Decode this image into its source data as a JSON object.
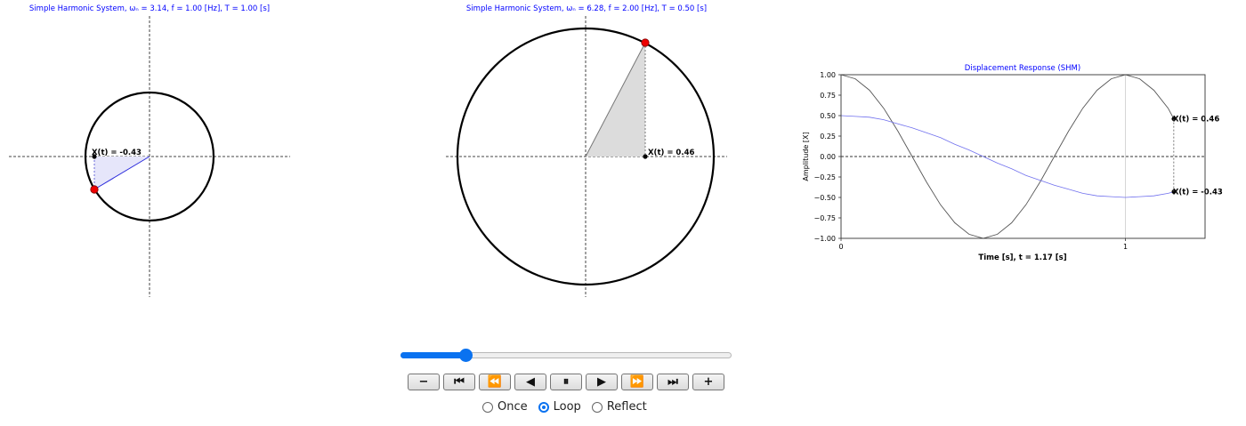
{
  "panel_left": {
    "title": "Simple Harmonic System, ωₙ  = 3.14, f = 1.00 [Hz], T = 1.00 [s]",
    "label": "X(t) = -0.43",
    "title_color": "#0000ff",
    "shade_color": "#e6e6fa",
    "radius_color": "#2b2bdc"
  },
  "panel_middle": {
    "title": "Simple Harmonic System, ωₙ  = 6.28, f = 2.00 [Hz], T = 0.50 [s]",
    "label": "X(t) = 0.46",
    "title_color": "#0000ff",
    "shade_color": "#dcdcdc",
    "radius_color": "#777777"
  },
  "chart_data": {
    "type": "line",
    "title": "Displacement Response (SHM)",
    "xlabel": "Time [s], t = 1.17 [s]",
    "ylabel": "Amplitude [X]",
    "xlim": [
      0,
      1.28
    ],
    "ylim": [
      -1.0,
      1.0
    ],
    "xticks": [
      "0",
      "1"
    ],
    "xtick_values": [
      0,
      1
    ],
    "yticks": [
      "1.00",
      "0.75",
      "0.50",
      "0.25",
      "0.00",
      "−0.25",
      "−0.50",
      "−0.75",
      "−1.00"
    ],
    "ytick_values": [
      1.0,
      0.75,
      0.5,
      0.25,
      0.0,
      -0.25,
      -0.5,
      -0.75,
      -1.0
    ],
    "current_t": 1.17,
    "series": [
      {
        "color": "#555555",
        "x": [
          0,
          0.05,
          0.1,
          0.15,
          0.2,
          0.25,
          0.3,
          0.35,
          0.4,
          0.45,
          0.5,
          0.55,
          0.6,
          0.65,
          0.7,
          0.75,
          0.8,
          0.85,
          0.9,
          0.95,
          1.0,
          1.05,
          1.1,
          1.15,
          1.17
        ],
        "y": [
          1.0,
          0.95,
          0.81,
          0.59,
          0.31,
          0.0,
          -0.31,
          -0.59,
          -0.81,
          -0.95,
          -1.0,
          -0.95,
          -0.81,
          -0.59,
          -0.31,
          0.0,
          0.31,
          0.59,
          0.81,
          0.95,
          1.0,
          0.95,
          0.81,
          0.59,
          0.46
        ],
        "end_label": "X(t) = 0.46"
      },
      {
        "color": "#7070ee",
        "x": [
          0,
          0.05,
          0.1,
          0.15,
          0.2,
          0.25,
          0.3,
          0.35,
          0.4,
          0.45,
          0.5,
          0.55,
          0.6,
          0.65,
          0.7,
          0.75,
          0.8,
          0.85,
          0.9,
          0.95,
          1.0,
          1.05,
          1.1,
          1.15,
          1.17
        ],
        "y": [
          0.5,
          0.49,
          0.48,
          0.45,
          0.4,
          0.35,
          0.29,
          0.23,
          0.15,
          0.08,
          0.0,
          -0.08,
          -0.15,
          -0.23,
          -0.29,
          -0.35,
          -0.4,
          -0.45,
          -0.48,
          -0.49,
          -0.5,
          -0.49,
          -0.48,
          -0.45,
          -0.43
        ],
        "end_label": "X(t) = -0.43"
      }
    ],
    "title_color": "#0000ff",
    "grid": false
  },
  "player": {
    "progress": 0.2,
    "buttons": [
      {
        "name": "slower-button",
        "icon": "minus-icon",
        "glyph": "−"
      },
      {
        "name": "first-frame-button",
        "icon": "first-frame-icon",
        "glyph": "⏮"
      },
      {
        "name": "step-back-button",
        "icon": "step-back-icon",
        "glyph": "⏪"
      },
      {
        "name": "play-reverse-button",
        "icon": "play-reverse-icon",
        "glyph": "◀"
      },
      {
        "name": "pause-button",
        "icon": "pause-icon",
        "glyph": "⏸"
      },
      {
        "name": "play-button",
        "icon": "play-icon",
        "glyph": "▶"
      },
      {
        "name": "step-forward-button",
        "icon": "step-forward-icon",
        "glyph": "⏩"
      },
      {
        "name": "last-frame-button",
        "icon": "last-frame-icon",
        "glyph": "⏭"
      },
      {
        "name": "faster-button",
        "icon": "plus-icon",
        "glyph": "+"
      }
    ],
    "modes": [
      {
        "label": "Once",
        "selected": false
      },
      {
        "label": "Loop",
        "selected": true
      },
      {
        "label": "Reflect",
        "selected": false
      }
    ],
    "accent": "#0a72f0"
  }
}
